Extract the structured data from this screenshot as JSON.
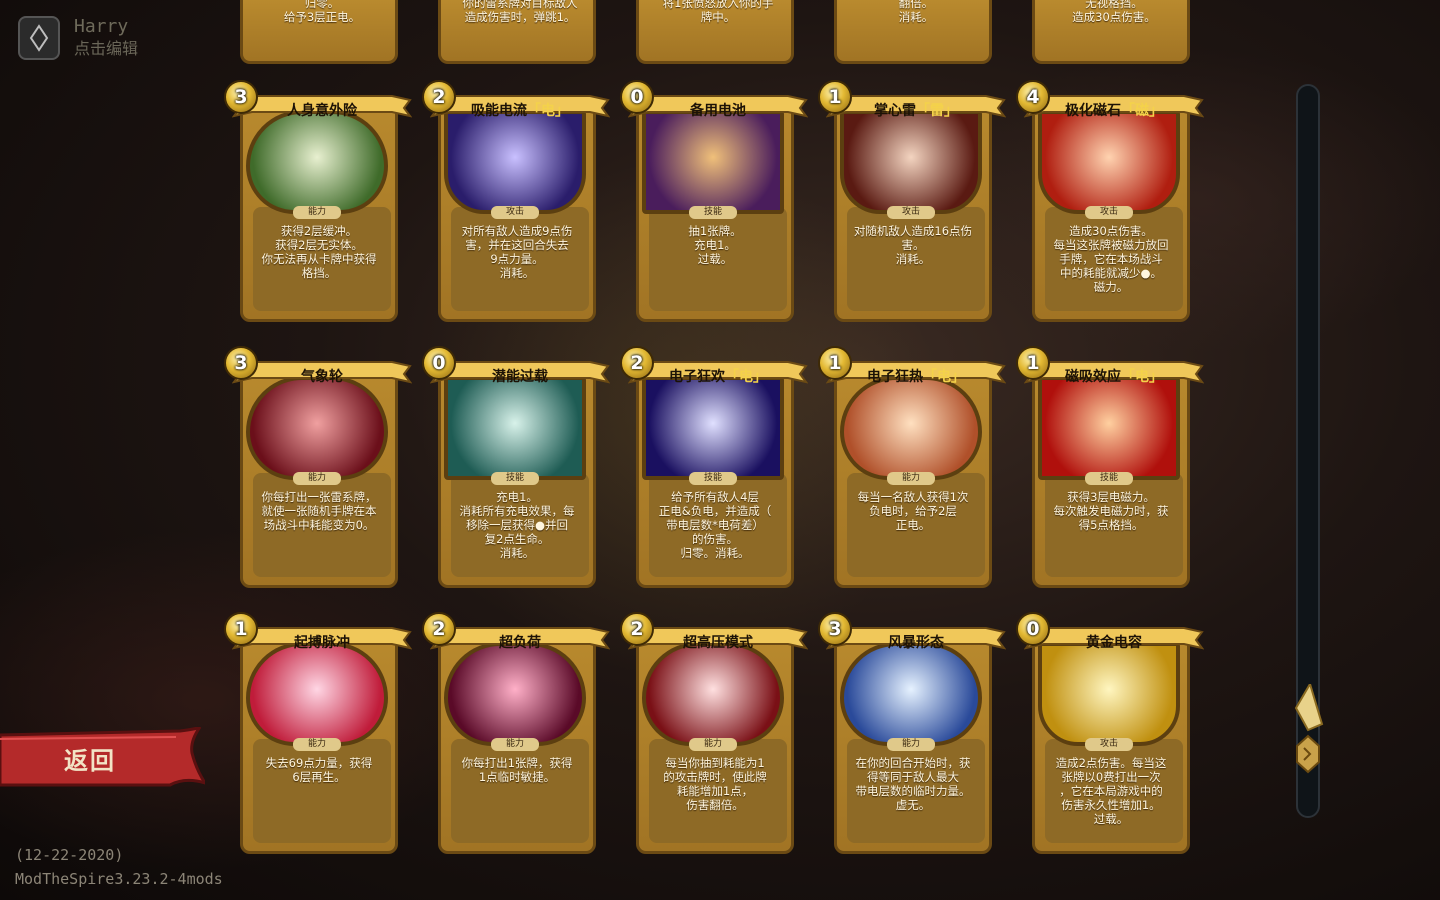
{
  "profile": {
    "name": "Harry",
    "edit": "点击编辑"
  },
  "return_label": "返回",
  "version": {
    "date": "(12-22-2020)",
    "mods": "ModTheSpire3.23.2-4mods"
  },
  "top_partial": [
    "归零。\n给予3层正电。",
    "你的雷系牌对目标敌人\n造成伤害时，弹跳1。",
    "将1张愤怒放入你的手\n牌中。",
    "翻倍。\n消耗。",
    "无视格挡。\n造成30点伤害。"
  ],
  "cards": [
    {
      "cost": "3",
      "title": "人身意外险",
      "tag": "",
      "type": "能力",
      "art": "power",
      "colors": [
        "#e8f0d0",
        "#3f6b2a"
      ],
      "desc": "获得2层缓冲。\n获得2层无实体。\n你无法再从卡牌中获得\n格挡。"
    },
    {
      "cost": "2",
      "title": "吸能电流",
      "tag": "「电」",
      "type": "攻击",
      "art": "attack",
      "colors": [
        "#c9c0ff",
        "#2a1d6b"
      ],
      "desc": "对所有敌人造成9点伤\n害，并在这回合失去\n9点力量。\n消耗。"
    },
    {
      "cost": "0",
      "title": "备用电池",
      "tag": "",
      "type": "技能",
      "art": "skill",
      "colors": [
        "#f0c07a",
        "#4a1d5c"
      ],
      "desc": "抽1张牌。\n充电1。\n过载。"
    },
    {
      "cost": "1",
      "title": "掌心雷",
      "tag": "「雷」",
      "type": "攻击",
      "art": "attack",
      "colors": [
        "#f3d4c0",
        "#5a1a12"
      ],
      "desc": "对随机敌人造成16点伤\n害。\n消耗。"
    },
    {
      "cost": "4",
      "title": "极化磁石",
      "tag": "「磁」",
      "type": "攻击",
      "art": "attack",
      "colors": [
        "#ffd3b0",
        "#b01e10"
      ],
      "desc": "造成30点伤害。\n每当这张牌被磁力放回\n手牌，它在本场战斗\n中的耗能就减少●。\n磁力。"
    },
    {
      "cost": "3",
      "title": "气象轮",
      "tag": "",
      "type": "能力",
      "art": "power",
      "colors": [
        "#f0a0a0",
        "#6b0f1a"
      ],
      "desc": "你每打出一张雷系牌，\n就使一张随机手牌在本\n场战斗中耗能变为0。"
    },
    {
      "cost": "0",
      "title": "潜能过载",
      "tag": "",
      "type": "技能",
      "art": "skill",
      "colors": [
        "#d8f2ea",
        "#1e5c54"
      ],
      "desc": "充电1。\n消耗所有充电效果，每\n移除一层获得●并回\n复2点生命。\n消耗。"
    },
    {
      "cost": "2",
      "title": "电子狂欢",
      "tag": "「电」",
      "type": "技能",
      "art": "skill",
      "colors": [
        "#e0e0ff",
        "#1a1060"
      ],
      "desc": "给予所有敌人4层\n正电&负电，并造成（\n带电层数*电荷差）\n的伤害。\n归零。消耗。"
    },
    {
      "cost": "1",
      "title": "电子狂热",
      "tag": "「电」",
      "type": "能力",
      "art": "power",
      "colors": [
        "#ffe0c0",
        "#b0502a"
      ],
      "desc": "每当一名敌人获得1次\n负电时，给予2层\n正电。"
    },
    {
      "cost": "1",
      "title": "磁吸效应",
      "tag": "「电」",
      "type": "技能",
      "art": "skill",
      "colors": [
        "#ffd0a0",
        "#b0100c"
      ],
      "desc": "获得3层电磁力。\n每次触发电磁力时，获\n得5点格挡。"
    },
    {
      "cost": "1",
      "title": "起搏脉冲",
      "tag": "",
      "type": "能力",
      "art": "power",
      "colors": [
        "#ffd6e4",
        "#c01c3a"
      ],
      "desc": "失去69点力量，获得\n6层再生。"
    },
    {
      "cost": "2",
      "title": "超负荷",
      "tag": "",
      "type": "能力",
      "art": "power",
      "colors": [
        "#ffb0c8",
        "#5a0a28"
      ],
      "desc": "你每打出1张牌，获得\n1点临时敏捷。"
    },
    {
      "cost": "2",
      "title": "超高压模式",
      "tag": "",
      "type": "能力",
      "art": "power",
      "colors": [
        "#ffe0e0",
        "#7a1016"
      ],
      "desc": "每当你抽到耗能为1\n的攻击牌时，使此牌\n耗能增加1点，\n伤害翻倍。"
    },
    {
      "cost": "3",
      "title": "风暴形态",
      "tag": "",
      "type": "能力",
      "art": "power",
      "colors": [
        "#e6f2ff",
        "#2a4a9a"
      ],
      "desc": "在你的回合开始时，获\n得等同于敌人最大\n带电层数的临时力量。\n虚无。"
    },
    {
      "cost": "0",
      "title": "黄金电容",
      "tag": "",
      "type": "攻击",
      "art": "attack",
      "colors": [
        "#fff6c0",
        "#c09010"
      ],
      "desc": "造成2点伤害。每当这\n张牌以0费打出一次\n，它在本局游戏中的\n伤害永久性增加1。\n过载。"
    }
  ]
}
